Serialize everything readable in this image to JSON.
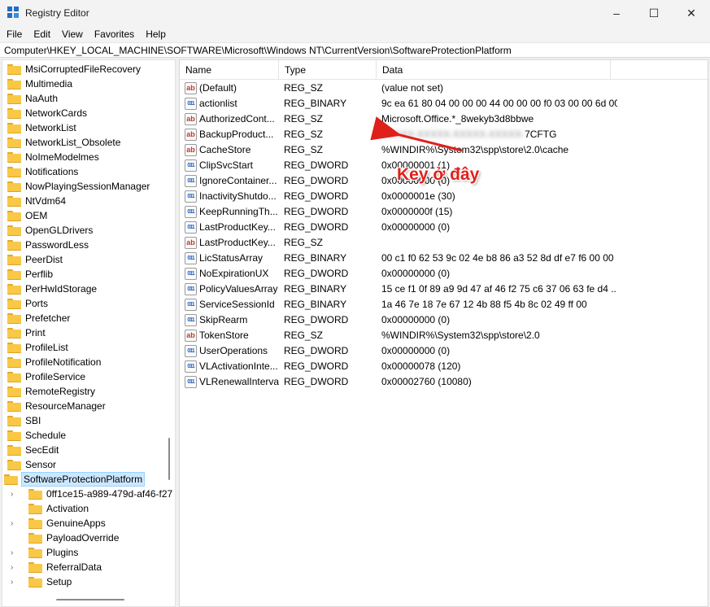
{
  "window": {
    "title": "Registry Editor",
    "minimize_glyph": "–",
    "maximize_glyph": "☐",
    "close_glyph": "✕"
  },
  "menu": [
    "File",
    "Edit",
    "View",
    "Favorites",
    "Help"
  ],
  "address": "Computer\\HKEY_LOCAL_MACHINE\\SOFTWARE\\Microsoft\\Windows NT\\CurrentVersion\\SoftwareProtectionPlatform",
  "tree": {
    "items": [
      "MsiCorruptedFileRecovery",
      "Multimedia",
      "NaAuth",
      "NetworkCards",
      "NetworkList",
      "NetworkList_Obsolete",
      "NoImeModelmes",
      "Notifications",
      "NowPlayingSessionManager",
      "NtVdm64",
      "OEM",
      "OpenGLDrivers",
      "PasswordLess",
      "PeerDist",
      "Perflib",
      "PerHwIdStorage",
      "Ports",
      "Prefetcher",
      "Print",
      "ProfileList",
      "ProfileNotification",
      "ProfileService",
      "RemoteRegistry",
      "ResourceManager",
      "SBI",
      "Schedule",
      "SecEdit",
      "Sensor"
    ],
    "selected": "SoftwareProtectionPlatform",
    "children": [
      {
        "label": "0ff1ce15-a989-479d-af46-f27",
        "expandable": true
      },
      {
        "label": "Activation",
        "expandable": false
      },
      {
        "label": "GenuineApps",
        "expandable": true
      },
      {
        "label": "PayloadOverride",
        "expandable": false
      },
      {
        "label": "Plugins",
        "expandable": true
      },
      {
        "label": "ReferralData",
        "expandable": true
      },
      {
        "label": "Setup",
        "expandable": true
      }
    ]
  },
  "columns": {
    "name": "Name",
    "type": "Type",
    "data": "Data"
  },
  "values": [
    {
      "name": "(Default)",
      "type": "REG_SZ",
      "data": "(value not set)",
      "icon": "string-value-icon"
    },
    {
      "name": "actionlist",
      "type": "REG_BINARY",
      "data": "9c ea 61 80 04 00 00 00 44 00 00 00 f0 03 00 00 6d 00...",
      "icon": "binary-value-icon"
    },
    {
      "name": "AuthorizedCont...",
      "type": "REG_SZ",
      "data": "Microsoft.Office.*_8wekyb3d8bbwe",
      "icon": "string-value-icon"
    },
    {
      "name": "BackupProduct...",
      "type": "REG_SZ",
      "data_hidden": "XXXXX-XXXXX-XXXXX-XXXXX-",
      "data": "7CFTG",
      "icon": "string-value-icon"
    },
    {
      "name": "CacheStore",
      "type": "REG_SZ",
      "data": "%WINDIR%\\System32\\spp\\store\\2.0\\cache",
      "icon": "string-value-icon"
    },
    {
      "name": "ClipSvcStart",
      "type": "REG_DWORD",
      "data": "0x00000001 (1)",
      "icon": "binary-value-icon"
    },
    {
      "name": "IgnoreContainer...",
      "type": "REG_DWORD",
      "data": "0x00000000 (0)",
      "icon": "binary-value-icon"
    },
    {
      "name": "InactivityShutdo...",
      "type": "REG_DWORD",
      "data": "0x0000001e (30)",
      "icon": "binary-value-icon"
    },
    {
      "name": "KeepRunningTh...",
      "type": "REG_DWORD",
      "data": "0x0000000f (15)",
      "icon": "binary-value-icon"
    },
    {
      "name": "LastProductKey...",
      "type": "REG_DWORD",
      "data": "0x00000000 (0)",
      "icon": "binary-value-icon"
    },
    {
      "name": "LastProductKey...",
      "type": "REG_SZ",
      "data": "",
      "icon": "string-value-icon"
    },
    {
      "name": "LicStatusArray",
      "type": "REG_BINARY",
      "data": "00 c1 f0 62 53 9c 02 4e b8 86 a3 52 8d df e7 f6 00 00 ...",
      "icon": "binary-value-icon"
    },
    {
      "name": "NoExpirationUX",
      "type": "REG_DWORD",
      "data": "0x00000000 (0)",
      "icon": "binary-value-icon"
    },
    {
      "name": "PolicyValuesArray",
      "type": "REG_BINARY",
      "data": "15 ce f1 0f 89 a9 9d 47 af 46 f2 75 c6 37 06 63 fe d4 ...",
      "icon": "binary-value-icon"
    },
    {
      "name": "ServiceSessionId",
      "type": "REG_BINARY",
      "data": "1a 46 7e 18 7e 67 12 4b 88 f5 4b 8c 02 49 ff 00",
      "icon": "binary-value-icon"
    },
    {
      "name": "SkipRearm",
      "type": "REG_DWORD",
      "data": "0x00000000 (0)",
      "icon": "binary-value-icon"
    },
    {
      "name": "TokenStore",
      "type": "REG_SZ",
      "data": "%WINDIR%\\System32\\spp\\store\\2.0",
      "icon": "string-value-icon"
    },
    {
      "name": "UserOperations",
      "type": "REG_DWORD",
      "data": "0x00000000 (0)",
      "icon": "binary-value-icon"
    },
    {
      "name": "VLActivationInte...",
      "type": "REG_DWORD",
      "data": "0x00000078 (120)",
      "icon": "binary-value-icon"
    },
    {
      "name": "VLRenewalInterval",
      "type": "REG_DWORD",
      "data": "0x00002760 (10080)",
      "icon": "binary-value-icon"
    }
  ],
  "annotation": {
    "text": "Key ở đây",
    "color": "#e0201b"
  },
  "icons": {
    "string": "ab",
    "binary": "011"
  },
  "colors": {
    "folder": "#f8c846",
    "selection": "#cce8ff",
    "annotation": "#e0201b"
  }
}
